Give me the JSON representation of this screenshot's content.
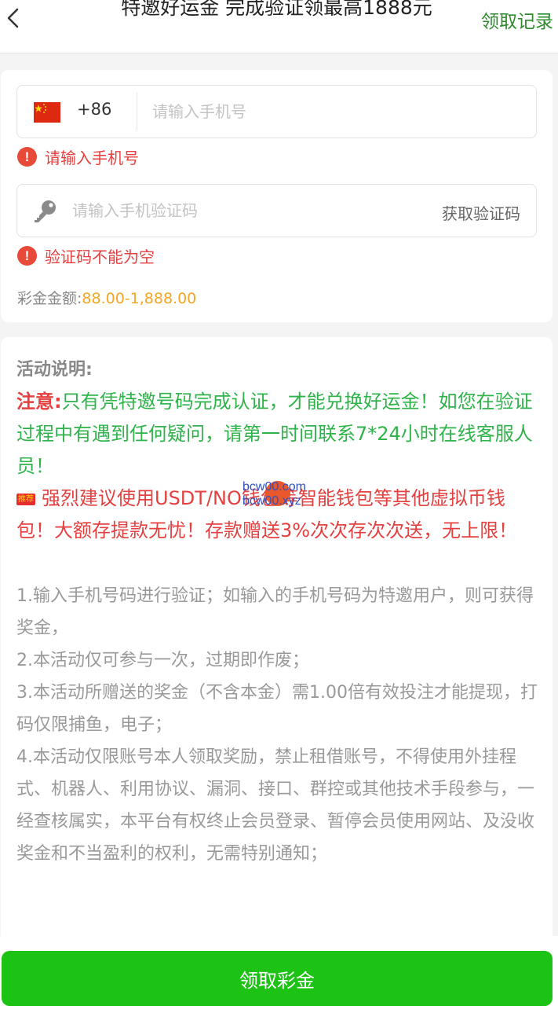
{
  "header": {
    "title": "特邀好运金 完成验证领最高1888元",
    "record_link": "领取记录"
  },
  "form": {
    "country_code": "+86",
    "phone_placeholder": "请输入手机号",
    "phone_error": "请输入手机号",
    "code_placeholder": "请输入手机验证码",
    "get_code_label": "获取验证码",
    "code_error": "验证码不能为空",
    "amount_label": "彩金金额:",
    "amount_value": "88.00-1,888.00",
    "flag_icon": "china-flag-icon",
    "key_icon": "key-icon",
    "error_icon": "!"
  },
  "info": {
    "heading": "活动说明:",
    "notice_label": "注意:",
    "notice_text": "只有凭特邀号码完成认证，才能兑换好运金！如您在验证过程中有遇到任何疑问，请第一时间联系7*24小时在线客服人员！",
    "promo_badge": "推荐",
    "promo_text": "强烈建议使用USDT/NO钱包等智能钱包等其他虚拟币钱包！大额存提款无忧！存款赠送3%次次存次次送，无上限！",
    "watermark_lines": [
      "bcw00.com",
      "bcw00.xyz"
    ],
    "rules": [
      "1.输入手机号码进行验证；如输入的手机号码为特邀用户，则可获得奖金，",
      "2.本活动仅可参与一次，过期即作废；",
      "3.本活动所赠送的奖金（不含本金）需1.00倍有效投注才能提现，打码仅限捕鱼，电子；",
      "4.本活动仅限账号本人领取奖励，禁止租借账号，不得使用外挂程式、机器人、利用协议、漏洞、接口、群控或其他技术手段参与，一经查核属实，本平台有权终止会员登录、暂停会员使用网站、及没收奖金和不当盈利的权利，无需特别通知；"
    ]
  },
  "footer": {
    "claim_button": "领取彩金"
  },
  "colors": {
    "accent_green": "#1cc315",
    "record_green": "#2e8b2e",
    "error_red": "#e54040",
    "amount_orange": "#f5a623",
    "notice_green": "#2fb34a"
  }
}
